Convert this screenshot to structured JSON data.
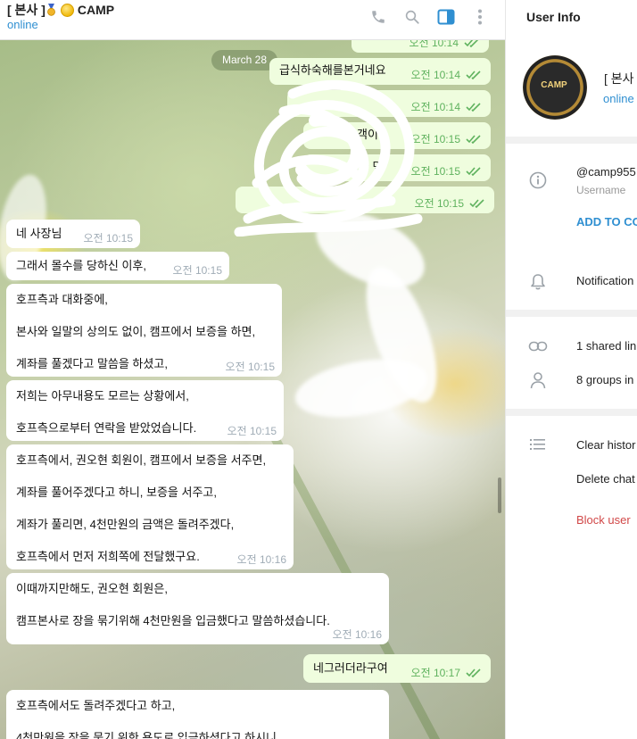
{
  "chat": {
    "title_prefix": "[ 본사 ]",
    "title_suffix": "CAMP",
    "status": "online",
    "date": "March 28"
  },
  "header_icons": [
    "phone-icon",
    "search-icon",
    "sidebar-toggle-icon",
    "more-vertical-icon"
  ],
  "messages_out": [
    {
      "text": "",
      "time": "오전 10:14"
    },
    {
      "text": "급식하숙해를본거네요",
      "time": "오전 10:14"
    },
    {
      "text": "",
      "time": "오전 10:14"
    },
    {
      "text": "객이",
      "time": "오전 10:15"
    },
    {
      "text": "내좋 면",
      "time": "오전 10:15"
    },
    {
      "text": "",
      "time": "오전 10:15"
    }
  ],
  "messages_in": [
    {
      "lines": [
        "네 사장님"
      ],
      "time": "오전 10:15"
    },
    {
      "lines": [
        "그래서 몰수를 당하신 이후,"
      ],
      "time": "오전 10:15"
    },
    {
      "lines": [
        "호프측과 대화중에,",
        "본사와 일말의 상의도 없이, 캠프에서 보증을 하면,",
        "계좌를 풀겠다고 말씀을 하셨고,"
      ],
      "time": "오전 10:15"
    },
    {
      "lines": [
        "저희는 아무내용도 모르는 상황에서,",
        "호프측으로부터 연락을 받았었습니다."
      ],
      "time": "오전 10:15"
    },
    {
      "lines": [
        "호프측에서, 권오현 회원이, 캠프에서 보증을 서주면,",
        "계좌를 풀어주겠다고 하니, 보증을 서주고,",
        "계좌가 풀리면, 4천만원의 금액은 돌려주겠다,",
        "호프측에서 먼저 저희쪽에 전달했구요."
      ],
      "time": "오전 10:16"
    },
    {
      "lines": [
        "이때까지만해도, 권오현 회원은,",
        "캠프본사로 장을 묶기위해 4천만원을 입금했다고 말씀하셨습니다."
      ],
      "time": "오전 10:16"
    },
    {
      "lines": [
        "호프측에서도 돌려주겠다고 하고,",
        "4천만원을 장을 묶기 위한 용도로 입금하셨다고 하시니"
      ],
      "time": ""
    }
  ],
  "reply_out": {
    "text": "네그러더라구여",
    "time": "오전 10:17"
  },
  "info": {
    "title": "User Info",
    "name": "[ 본사",
    "status": "online",
    "avatar_text": "CAMP",
    "username": "@camp955",
    "username_label": "Username",
    "add_contact": "ADD TO CO",
    "notifications": "Notification",
    "shared_links": "1 shared lin",
    "groups": "8 groups in",
    "clear_history": "Clear histor",
    "delete_chat": "Delete chat",
    "block_user": "Block user"
  },
  "colors": {
    "accent": "#2f8fd1",
    "out_bubble": "#effdde",
    "danger": "#d14848",
    "check": "#5fb25e"
  }
}
